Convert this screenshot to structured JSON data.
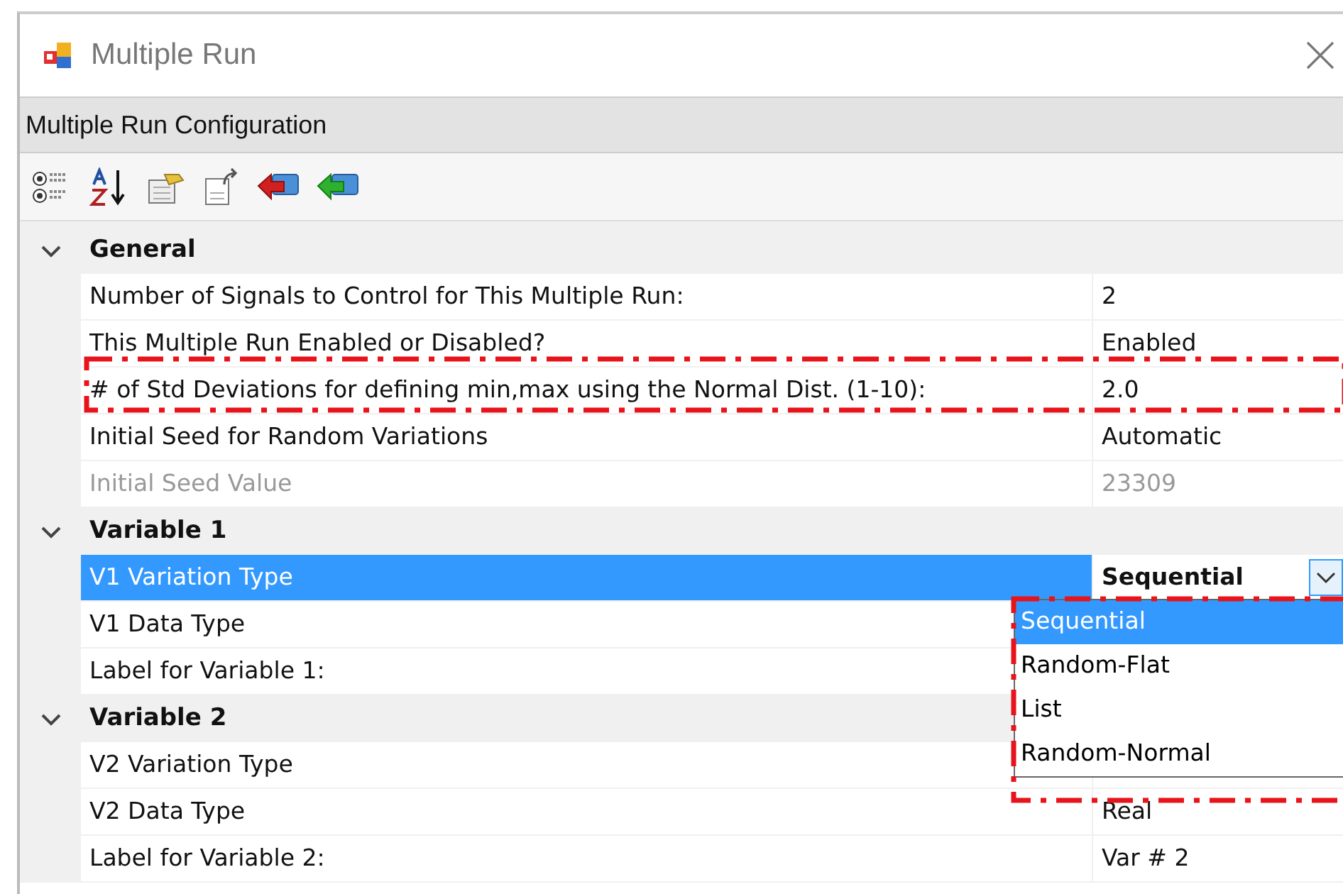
{
  "window": {
    "title": "Multiple Run"
  },
  "header": {
    "title": "Multiple Run Configuration"
  },
  "categories": [
    {
      "title": "General",
      "expanded": true,
      "properties": [
        {
          "label": "Number of Signals to Control for This Multiple Run:",
          "value": "2",
          "disabled": false,
          "selected": false,
          "modified": false,
          "annotated": false
        },
        {
          "label": "This Multiple Run Enabled or Disabled?",
          "value": "Enabled",
          "disabled": false,
          "selected": false,
          "modified": false,
          "annotated": false
        },
        {
          "label": "# of Std Deviations for defining min,max using the Normal Dist. (1-10):",
          "value": "2.0",
          "disabled": false,
          "selected": false,
          "modified": false,
          "annotated": true
        },
        {
          "label": "Initial Seed for Random Variations",
          "value": "Automatic",
          "disabled": false,
          "selected": false,
          "modified": false,
          "annotated": false
        },
        {
          "label": "Initial Seed Value",
          "value": "23309",
          "disabled": true,
          "selected": false,
          "modified": false,
          "annotated": false
        }
      ]
    },
    {
      "title": "Variable 1",
      "expanded": true,
      "properties": [
        {
          "label": "V1 Variation Type",
          "value": "Sequential",
          "disabled": false,
          "selected": true,
          "modified": true,
          "annotated": false,
          "dropdown": {
            "annotated": true,
            "items": [
              {
                "label": "Sequential",
                "selected": true
              },
              {
                "label": "Random-Flat",
                "selected": false
              },
              {
                "label": "List",
                "selected": false
              },
              {
                "label": "Random-Normal",
                "selected": false
              }
            ]
          }
        },
        {
          "label": "V1 Data Type",
          "disabled": false,
          "selected": false,
          "annotated": false
        },
        {
          "label": "Label for Variable 1:",
          "disabled": false,
          "selected": false,
          "annotated": false
        }
      ]
    },
    {
      "title": "Variable 2",
      "expanded": true,
      "properties": [
        {
          "label": "V2 Variation Type",
          "disabled": false,
          "selected": false,
          "annotated": false
        },
        {
          "label": "V2 Data Type",
          "value": "Real",
          "disabled": false,
          "selected": false,
          "modified": false,
          "annotated": false
        },
        {
          "label": "Label for Variable 2:",
          "value": "Var # 2",
          "disabled": false,
          "selected": false,
          "modified": false,
          "annotated": false
        }
      ]
    }
  ]
}
